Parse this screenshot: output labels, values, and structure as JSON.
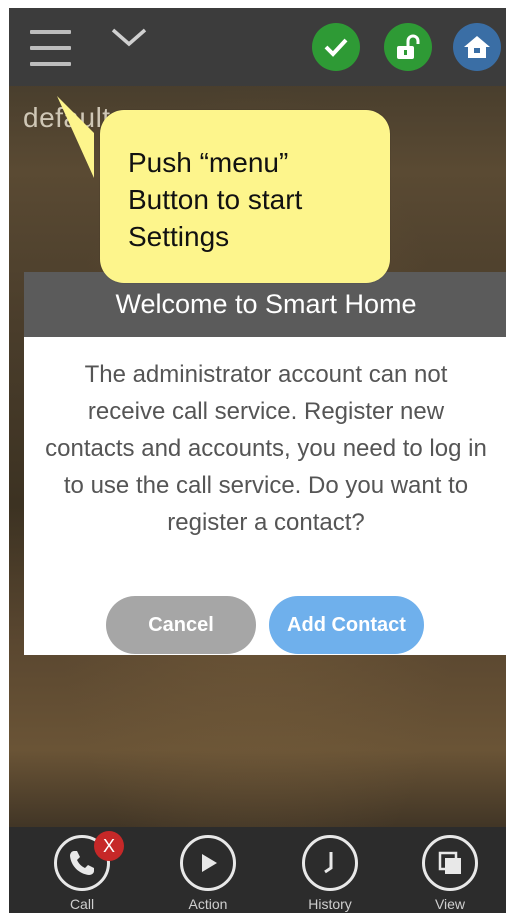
{
  "topbar": {
    "menu_icon": "hamburger-menu-icon",
    "dropdown_icon": "chevron-down-icon",
    "status_icons": [
      "checkmark-icon",
      "unlock-icon",
      "home-icon"
    ],
    "colors": {
      "ok": "#2e9a35",
      "lock": "#2e9a35",
      "home": "#3a6ea5"
    }
  },
  "device": {
    "name": "default"
  },
  "callout": {
    "text": "Push “menu”\nButton to start\nSettings",
    "color": "#fdf58c"
  },
  "dialog": {
    "title": "Welcome to Smart Home",
    "message": "The administrator account can not receive call service. Register new contacts and accounts, you need to log in to use the call service. Do you want to register a contact?",
    "cancel_label": "Cancel",
    "add_label": "Add Contact"
  },
  "bottom_nav": {
    "call": {
      "label": "Call",
      "badge": "X"
    },
    "action": {
      "label": "Action"
    },
    "history": {
      "label": "History"
    },
    "view": {
      "label": "View"
    }
  }
}
